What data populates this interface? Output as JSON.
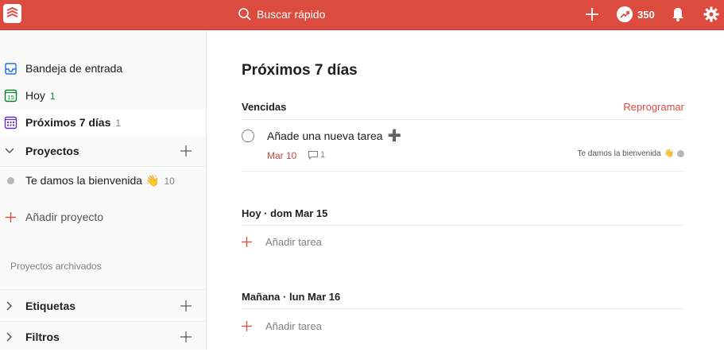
{
  "header": {
    "search_placeholder": "Buscar rápido",
    "karma_points": "350",
    "accent_color": "#db4c3f",
    "icons": [
      "todoist-logo-icon",
      "search-icon",
      "add-icon",
      "karma-icon",
      "bell-icon",
      "gear-icon"
    ]
  },
  "sidebar": {
    "items": [
      {
        "label": "Bandeja de entrada",
        "count": "",
        "icon": "inbox-icon"
      },
      {
        "label": "Hoy",
        "count": "1",
        "icon": "calendar-today-icon"
      },
      {
        "label": "Próximos 7 días",
        "count": "1",
        "icon": "calendar-week-icon"
      }
    ],
    "projects": {
      "label": "Proyectos",
      "items": [
        {
          "label": "Te damos la bienvenida",
          "emoji": "👋",
          "count": "10"
        }
      ],
      "add_label": "Añadir proyecto"
    },
    "archived_label": "Proyectos archivados",
    "labels_label": "Etiquetas",
    "filters_label": "Filtros"
  },
  "main": {
    "title": "Próximos 7 días",
    "overdue": {
      "title": "Vencidas",
      "reschedule": "Reprogramar",
      "task": {
        "text": "Añade una nueva tarea",
        "suffix": "➕",
        "date": "Mar 10",
        "comments": "1",
        "project": "Te damos la bienvenida",
        "project_emoji": "👋"
      }
    },
    "days": [
      {
        "title": "Hoy · dom Mar 15",
        "add_label": "Añadir tarea"
      },
      {
        "title": "Mañana · lun Mar 16",
        "add_label": "Añadir tarea"
      }
    ]
  }
}
